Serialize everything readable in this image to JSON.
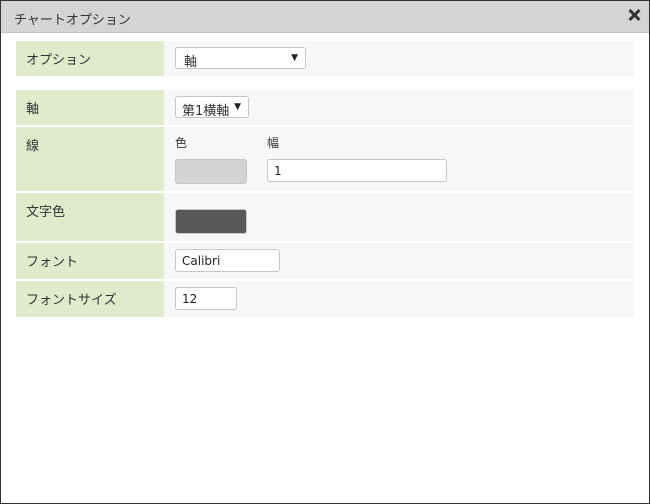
{
  "dialog": {
    "title": "チャートオプション"
  },
  "rows": {
    "option": {
      "label": "オプション",
      "select_value": "軸"
    },
    "axis": {
      "label": "軸",
      "select_value": "第1横軸"
    },
    "line": {
      "label": "線",
      "color_label": "色",
      "width_label": "幅",
      "width_value": "1",
      "color": "#d3d3d3"
    },
    "text_color": {
      "label": "文字色",
      "color": "#595959"
    },
    "font": {
      "label": "フォント",
      "value": "Calibri"
    },
    "font_size": {
      "label": "フォントサイズ",
      "value": "12"
    }
  },
  "icons": {
    "close": "close-icon",
    "dropdown": "chevron-down-icon"
  }
}
